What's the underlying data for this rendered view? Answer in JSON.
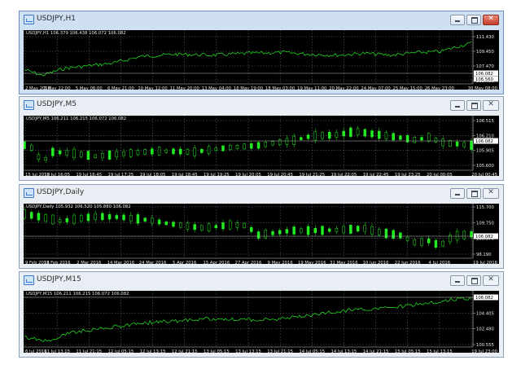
{
  "windows": [
    {
      "title": "USDJPY,H1",
      "active": true,
      "info": "USDJPY,H1  106.379 106.438 106.072 106.082",
      "current_price": "106.082",
      "last_price_label": "106.560",
      "x_labels": [
        "2 May 2016",
        "3 May 22:00",
        "5 May 06:00",
        "6 May 21:00",
        "10 May 12:00",
        "11 May 20:00",
        "13 May 04:00",
        "16 May 19:00",
        "18 May 03:00",
        "19 May 11:00",
        "20 May 22:00",
        "24 May 07:00",
        "25 May 15:00",
        "26 May 23:00",
        "30 May 08:00"
      ],
      "y_labels": [
        "111.430",
        "109.450",
        "107.470",
        "105.490"
      ]
    },
    {
      "title": "USDJPY,M5",
      "active": false,
      "info": "USDJPY,M5  106.211 106.215 106.072 106.082",
      "current_price": "106.082",
      "x_labels": [
        "15 Jul 2016",
        "19 Jul 16:05",
        "19 Jul 16:45",
        "19 Jul 17:25",
        "19 Jul 18:05",
        "19 Jul 18:45",
        "19 Jul 19:25",
        "19 Jul 20:05",
        "19 Jul 20:45",
        "19 Jul 21:25",
        "19 Jul 22:05",
        "19 Jul 22:45",
        "19 Jul 23:25",
        "20 Jul 00:05",
        "20 Jul 00:45"
      ],
      "y_labels": [
        "106.515",
        "106.210",
        "105.905",
        "105.600"
      ]
    },
    {
      "title": "USDJPY,Daily",
      "active": false,
      "info": "USDJPY,Daily  105.932 106.520 105.880 106.082",
      "current_price": "106.082",
      "x_labels": [
        "9 Feb 2016",
        "19 Feb 2016",
        "2 Mar 2016",
        "14 Mar 2016",
        "24 Mar 2016",
        "5 Apr 2016",
        "15 Apr 2016",
        "27 Apr 2016",
        "9 May 2016",
        "19 May 2016",
        "31 May 2016",
        "10 Jun 2016",
        "22 Jun 2016",
        "4 Jul 2016",
        "19 Jul 2016"
      ],
      "y_labels": [
        "115.700",
        "109.750",
        "103.970",
        "98.190"
      ]
    },
    {
      "title": "USDJPY,M15",
      "active": false,
      "info": "USDJPY,M15  106.211 106.215 106.072 106.082",
      "current_price": "106.082",
      "x_labels": [
        "6 Jul 2016",
        "11 Jul 13:15",
        "11 Jul 21:15",
        "12 Jul 05:15",
        "12 Jul 13:15",
        "12 Jul 21:15",
        "13 Jul 05:15",
        "13 Jul 13:15",
        "13 Jul 21:15",
        "14 Jul 05:15",
        "14 Jul 13:15",
        "14 Jul 21:15",
        "15 Jul 05:15",
        "15 Jul 13:15",
        "19 Jul 23:00"
      ],
      "y_labels": [
        "106.082",
        "104.405",
        "102.480",
        "100.555"
      ]
    }
  ],
  "colors": {
    "chart_bg": "#000000",
    "grid": "#6b7078",
    "series": "#22ee22",
    "text": "#e8e8e8",
    "current_line": "#c0c0c0",
    "price_tag_bg": "#ffffff",
    "price_tag_text": "#000000"
  }
}
